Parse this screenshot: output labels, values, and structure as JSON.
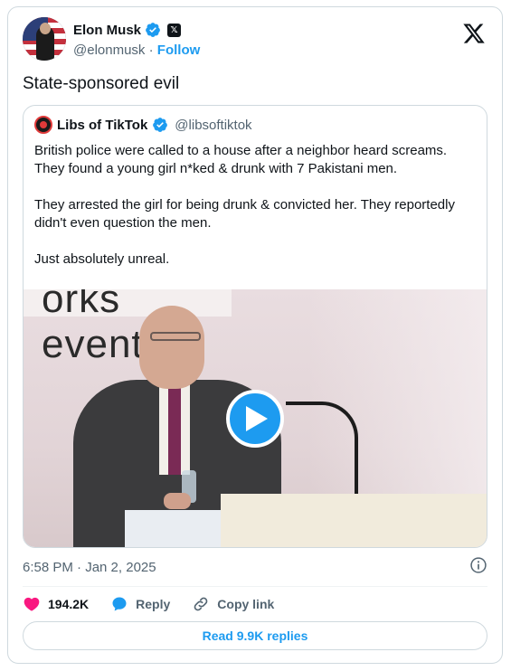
{
  "author": {
    "name": "Elon Musk",
    "handle": "@elonmusk",
    "separator": " · ",
    "follow_label": "Follow",
    "verified": true,
    "icons": [
      "verified-badge-icon",
      "x-affiliate-icon",
      "x-logo-icon"
    ]
  },
  "tweet": {
    "text": "State-sponsored evil",
    "timestamp": "6:58 PM · Jan 2, 2025"
  },
  "quote": {
    "name": "Libs of TikTok",
    "handle": "@libsoftiktok",
    "paragraphs": [
      "British police were called to a house after a neighbor heard screams. They found a young girl n*ked & drunk with 7 Pakistani men.",
      "They arrested the girl for being drunk & convicted her. They reportedly didn't even question the men.",
      "Just absolutely unreal."
    ],
    "video": {
      "banner_text": "orks event",
      "play_icon": "play-icon"
    }
  },
  "actions": {
    "like_count": "194.2K",
    "reply_label": "Reply",
    "copy_link_label": "Copy link"
  },
  "replies_button": "Read 9.9K replies",
  "colors": {
    "accent": "#1d9bf0",
    "like": "#f91880",
    "secondary_text": "#536471",
    "border": "#cfd9de"
  }
}
